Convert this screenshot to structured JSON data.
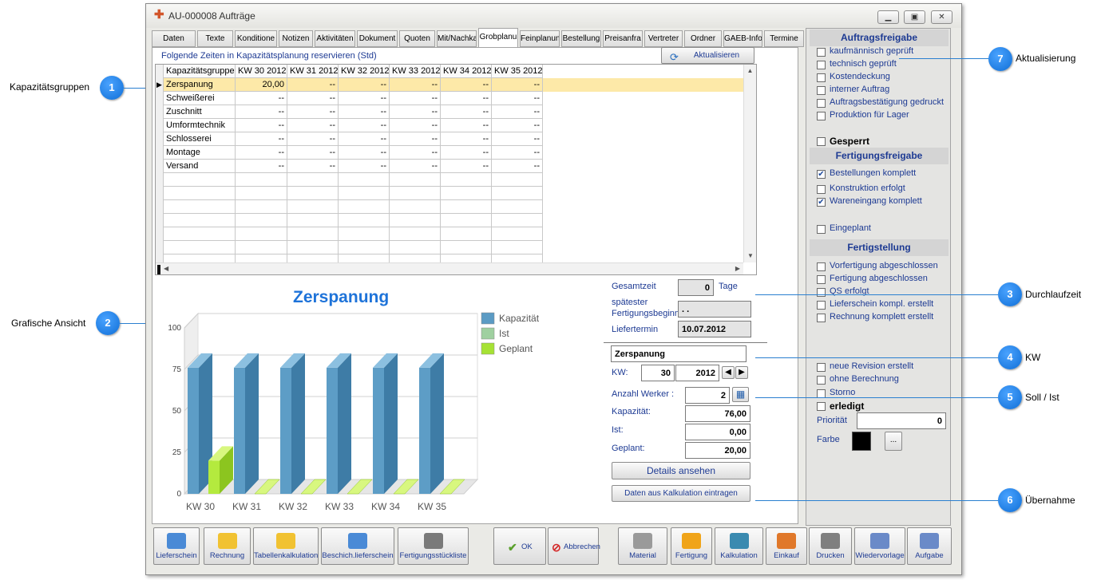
{
  "window": {
    "title": "AU-000008 Aufträge"
  },
  "tabs": [
    "Daten",
    "Texte",
    "Konditione",
    "Notizen",
    "Aktivitäten",
    "Dokument",
    "Quoten",
    "Mit/Nachka",
    "Grobplanu",
    "Feinplanun",
    "Bestellung",
    "Preisanfra",
    "Vertreter",
    "Ordner",
    "GAEB-Info",
    "Termine"
  ],
  "active_tab": "Grobplanu",
  "header": {
    "info": "Folgende Zeiten in Kapazitätsplanung reservieren (Std)",
    "refresh": "Aktualisieren"
  },
  "grid": {
    "columns": [
      "Kapazitätsgruppe",
      "KW 30 2012",
      "KW 31 2012",
      "KW 32 2012",
      "KW 33 2012",
      "KW 34 2012",
      "KW 35 2012"
    ],
    "rows": [
      [
        "Zerspanung",
        "20,00",
        "--",
        "--",
        "--",
        "--",
        "--"
      ],
      [
        "Schweißerei",
        "--",
        "--",
        "--",
        "--",
        "--",
        "--"
      ],
      [
        "Zuschnitt",
        "--",
        "--",
        "--",
        "--",
        "--",
        "--"
      ],
      [
        "Umformtechnik",
        "--",
        "--",
        "--",
        "--",
        "--",
        "--"
      ],
      [
        "Schlosserei",
        "--",
        "--",
        "--",
        "--",
        "--",
        "--"
      ],
      [
        "Montage",
        "--",
        "--",
        "--",
        "--",
        "--",
        "--"
      ],
      [
        "Versand",
        "--",
        "--",
        "--",
        "--",
        "--",
        "--"
      ]
    ]
  },
  "chart_data": {
    "type": "bar",
    "title": "Zerspanung",
    "categories": [
      "KW 30",
      "KW 31",
      "KW 32",
      "KW 33",
      "KW 34",
      "KW 35"
    ],
    "series": [
      {
        "name": "Kapazität",
        "values": [
          76,
          76,
          76,
          76,
          76,
          76
        ],
        "color": "#5b9bc4"
      },
      {
        "name": "Ist",
        "values": [
          0,
          0,
          0,
          0,
          0,
          0
        ],
        "color": "#9fd0a0"
      },
      {
        "name": "Geplant",
        "values": [
          20,
          0,
          0,
          0,
          0,
          0
        ],
        "color": "#a6e234"
      }
    ],
    "yticks": [
      "100",
      "75",
      "50",
      "25",
      "0"
    ],
    "ylim": [
      0,
      100
    ]
  },
  "details": {
    "gesamtzeit_label": "Gesamtzeit",
    "gesamtzeit": "0",
    "tage": "Tage",
    "spaetester_label": "spätester Fertigungsbeginn",
    "spaetester": ". .",
    "liefertermin_label": "Liefertermin",
    "liefertermin": "10.07.2012",
    "gruppe": "Zerspanung",
    "kw_label": "KW:",
    "kw": "30",
    "jahr": "2012",
    "werker_label": "Anzahl Werker :",
    "werker": "2",
    "kapazitaet_label": "Kapazität:",
    "kapazitaet": "76,00",
    "ist_label": "Ist:",
    "ist": "0,00",
    "geplant_label": "Geplant:",
    "geplant": "20,00",
    "details_btn": "Details ansehen",
    "kalk_btn": "Daten aus Kalkulation eintragen"
  },
  "right": {
    "auftragsfreigabe": "Auftragsfreigabe",
    "af_items": [
      {
        "label": "kaufmännisch geprüft",
        "checked": false
      },
      {
        "label": "technisch geprüft",
        "checked": false
      },
      {
        "label": "Kostendeckung",
        "checked": false
      },
      {
        "label": "interner Auftrag",
        "checked": false
      },
      {
        "label": "Auftragsbestätigung gedruckt",
        "checked": false
      },
      {
        "label": "Produktion für Lager",
        "checked": false
      }
    ],
    "gesperrt": "Gesperrt",
    "fertigungsfreigabe": "Fertigungsfreigabe",
    "ff_items": [
      {
        "label": "Bestellungen komplett",
        "checked": true
      },
      {
        "label": "Konstruktion erfolgt",
        "checked": false
      },
      {
        "label": "Wareneingang komplett",
        "checked": true
      }
    ],
    "eingeplant": "Eingeplant",
    "fertigstellung": "Fertigstellung",
    "fs_items": [
      {
        "label": "Vorfertigung abgeschlossen",
        "checked": false
      },
      {
        "label": "Fertigung abgeschlossen",
        "checked": false
      },
      {
        "label": "QS erfolgt",
        "checked": false
      },
      {
        "label": "Lieferschein kompl. erstellt",
        "checked": false
      },
      {
        "label": "Rechnung komplett erstellt",
        "checked": false
      }
    ],
    "neue_revision": "neue Revision erstellt",
    "ohne_berechnung": "ohne Berechnung",
    "storno": "Storno",
    "erledigt": "erledigt",
    "prioritaet_label": "Priorität",
    "prioritaet": "0",
    "farbe_label": "Farbe",
    "farbe_btn": "...",
    "farbe": "#000000"
  },
  "toolbar": [
    "Lieferschein",
    "Rechnung",
    "Tabellenkalkulation",
    "Beschich.lieferschein",
    "Fertigungsstückliste",
    "OK",
    "Abbrechen",
    "Material",
    "Fertigung",
    "Kalkulation",
    "Einkauf",
    "Drucken",
    "Wiedervorlage",
    "Aufgabe"
  ],
  "callouts": [
    {
      "num": "1",
      "label": "Kapazitätsgruppen"
    },
    {
      "num": "2",
      "label": "Grafische Ansicht"
    },
    {
      "num": "3",
      "label": "Durchlaufzeit"
    },
    {
      "num": "4",
      "label": "KW"
    },
    {
      "num": "5",
      "label": "Soll / Ist"
    },
    {
      "num": "6",
      "label": "Übernahme"
    },
    {
      "num": "7",
      "label": "Aktualisierung"
    }
  ]
}
